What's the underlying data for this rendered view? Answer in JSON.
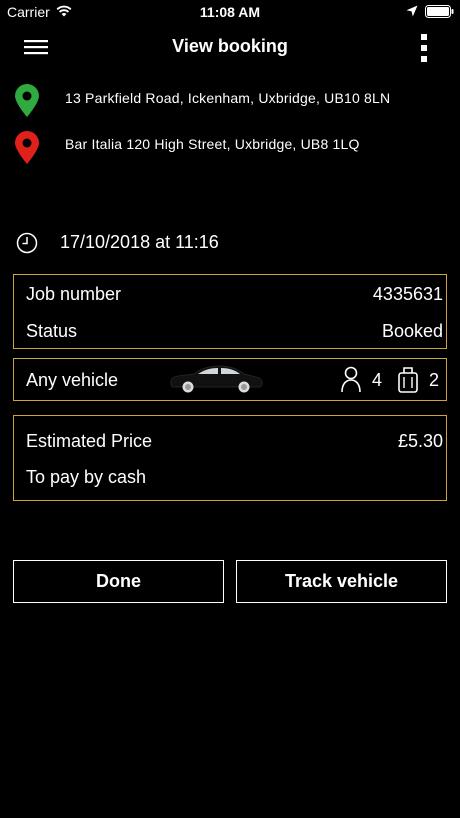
{
  "status_bar": {
    "carrier": "Carrier",
    "time": "11:08 AM",
    "icons": [
      "wifi-icon",
      "location-arrow-icon",
      "battery-icon"
    ]
  },
  "nav": {
    "title": "View booking",
    "icons": [
      "menu-icon",
      "more-icon"
    ]
  },
  "addresses": {
    "pickup": "13 Parkfield Road, Ickenham, Uxbridge, UB10 8LN",
    "dropoff": "Bar Italia 120 High Street, Uxbridge, UB8 1LQ",
    "pickup_pin_color": "#2faa3f",
    "dropoff_pin_color": "#e0201b"
  },
  "booking": {
    "datetime": "17/10/2018 at 11:16",
    "job_label": "Job number",
    "job_number": "4335631",
    "status_label": "Status",
    "status_value": "Booked"
  },
  "vehicle": {
    "label": "Any vehicle",
    "passengers": "4",
    "luggage": "2"
  },
  "price": {
    "label": "Estimated Price",
    "value": "£5.30",
    "payment": "To pay by cash"
  },
  "buttons": {
    "done": "Done",
    "track": "Track vehicle"
  },
  "colors": {
    "background": "#000000",
    "card_border": "#c9a53a",
    "text": "#ffffff"
  }
}
